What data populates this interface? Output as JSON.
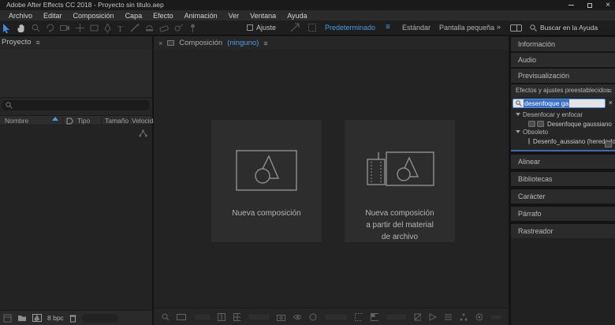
{
  "window": {
    "title": "Adobe After Effects CC 2018 - Proyecto sin titulo.aep"
  },
  "icons": {
    "menu": "≡",
    "close": "×",
    "chevron_double": "»",
    "clear": "×"
  },
  "menu": {
    "items": [
      "Archivo",
      "Editar",
      "Composición",
      "Capa",
      "Efecto",
      "Animación",
      "Ver",
      "Ventana",
      "Ayuda"
    ]
  },
  "toolbar": {
    "snap_label": "Ajuste",
    "workspaces": [
      {
        "label": "Predeterminado",
        "active": true
      },
      {
        "label": "Estándar",
        "active": false
      },
      {
        "label": "Pantalla pequeña",
        "active": false
      }
    ],
    "help_search_placeholder": "Buscar en la Ayuda"
  },
  "project_panel": {
    "title": "Proyecto",
    "columns": {
      "name": "Nombre",
      "type": "Tipo",
      "size": "Tamaño",
      "speed": "Velocida"
    },
    "footer": {
      "color_depth": "8 bpc"
    }
  },
  "composition_panel": {
    "tab_label": "Composición",
    "tab_state": "(ninguno)",
    "cards": [
      {
        "lines": [
          "Nueva composición"
        ]
      },
      {
        "lines": [
          "Nueva composición",
          "a partir del material",
          "de archivo"
        ]
      }
    ]
  },
  "right_panels": {
    "info": "Información",
    "audio": "Audio",
    "preview": "Previsualización",
    "effects": {
      "title": "Efectos y ajustes preestablecidos",
      "search_value": "desenfoque ga",
      "groups": [
        {
          "name": "Desenfocar y enfocar",
          "items": [
            "Desenfoque gaussiano"
          ]
        },
        {
          "name": "Obsoleto",
          "items": [
            "Desenfo_aussiano (heredado)"
          ]
        }
      ]
    },
    "align": "Alinear",
    "libraries": "Bibliotecas",
    "character": "Carácter",
    "paragraph": "Párrafo",
    "tracker": "Rastreador"
  },
  "colors": {
    "accent_blue": "#4a9bea",
    "selection_blue": "#3a70c8",
    "panel_bg": "#262626",
    "bar_bg": "#2b2b2b"
  }
}
